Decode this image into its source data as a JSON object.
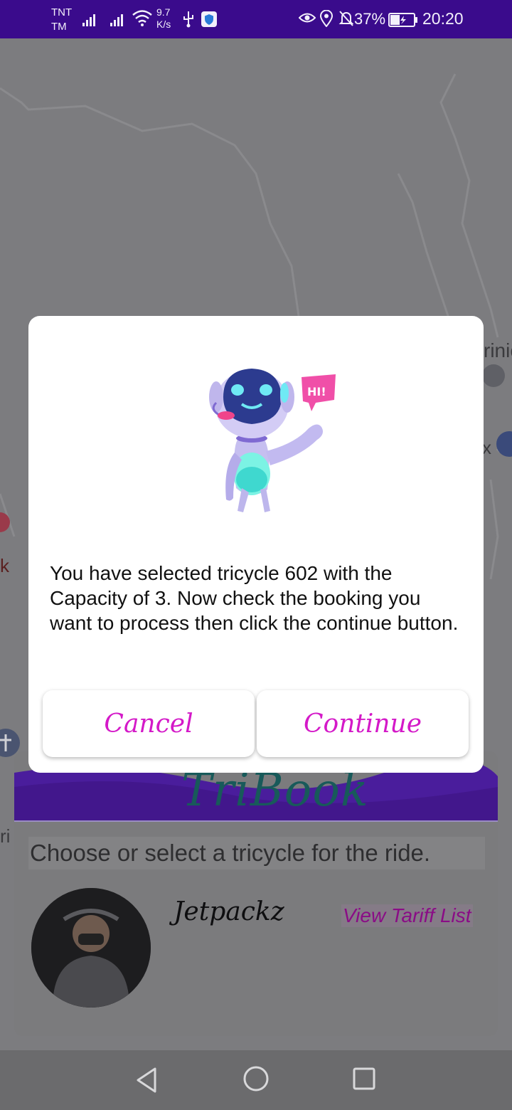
{
  "status_bar": {
    "carrier_line1": "TNT",
    "carrier_line2": "TM",
    "speed_value": "9.7",
    "speed_unit": "K/s",
    "battery": "37%",
    "time": "20:20",
    "icons": [
      "signal-icon",
      "signal-icon",
      "wifi-icon",
      "usb-icon",
      "shield-icon",
      "eye-icon",
      "location-icon",
      "mute-icon",
      "battery-icon"
    ]
  },
  "dialog": {
    "robot_badge": "HI!",
    "message": "You have selected tricycle 602 with the Capacity of 3. Now check the booking you want to process then click the continue button.",
    "cancel_label": "Cancel",
    "continue_label": "Continue"
  },
  "sheet": {
    "brand": "TriBook",
    "prompt": "Choose or select a tricycle for the ride.",
    "driver_name": "Jetpackz",
    "tariff_link": "View Tariff List"
  },
  "map": {
    "label_fragment_1": "rinic",
    "label_fragment_2": "x",
    "label_fragment_3": "k",
    "label_fragment_4": "ri"
  },
  "colors": {
    "status_bar": "#3a0b8c",
    "accent_pink": "#d419c8",
    "brand_purple": "#4a1d9c"
  }
}
